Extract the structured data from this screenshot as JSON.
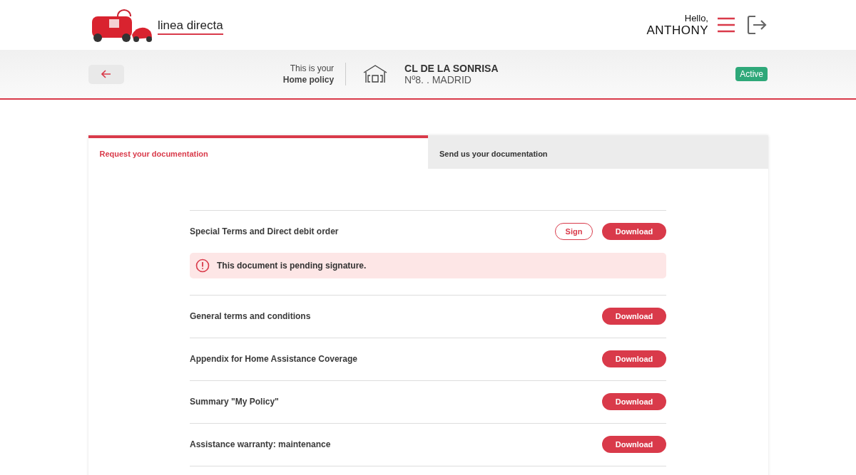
{
  "header": {
    "logo_text": "linea directa",
    "greeting": "Hello,",
    "user_name": "ANTHONY"
  },
  "policy_bar": {
    "intro": "This is your",
    "policy_type": "Home policy",
    "address_line_1": "CL DE LA SONRISA",
    "address_line_2": "Nº8. . MADRID",
    "status": "Active"
  },
  "tabs": [
    {
      "label": "Request your documentation",
      "selected": true
    },
    {
      "label": "Send us your documentation",
      "selected": false
    }
  ],
  "documents": [
    {
      "title": "Special Terms and Direct debit order",
      "actions": [
        {
          "kind": "sign",
          "label": "Sign"
        },
        {
          "kind": "download",
          "label": "Download"
        }
      ],
      "notice": "This document is pending signature."
    },
    {
      "title": "General terms and conditions",
      "actions": [
        {
          "kind": "download",
          "label": "Download"
        }
      ]
    },
    {
      "title": "Appendix for Home Assistance Coverage",
      "actions": [
        {
          "kind": "download",
          "label": "Download"
        }
      ]
    },
    {
      "title": "Summary \"My Policy\"",
      "actions": [
        {
          "kind": "download",
          "label": "Download"
        }
      ]
    },
    {
      "title": "Assistance warranty: maintenance",
      "actions": [
        {
          "kind": "download",
          "label": "Download"
        }
      ]
    }
  ]
}
